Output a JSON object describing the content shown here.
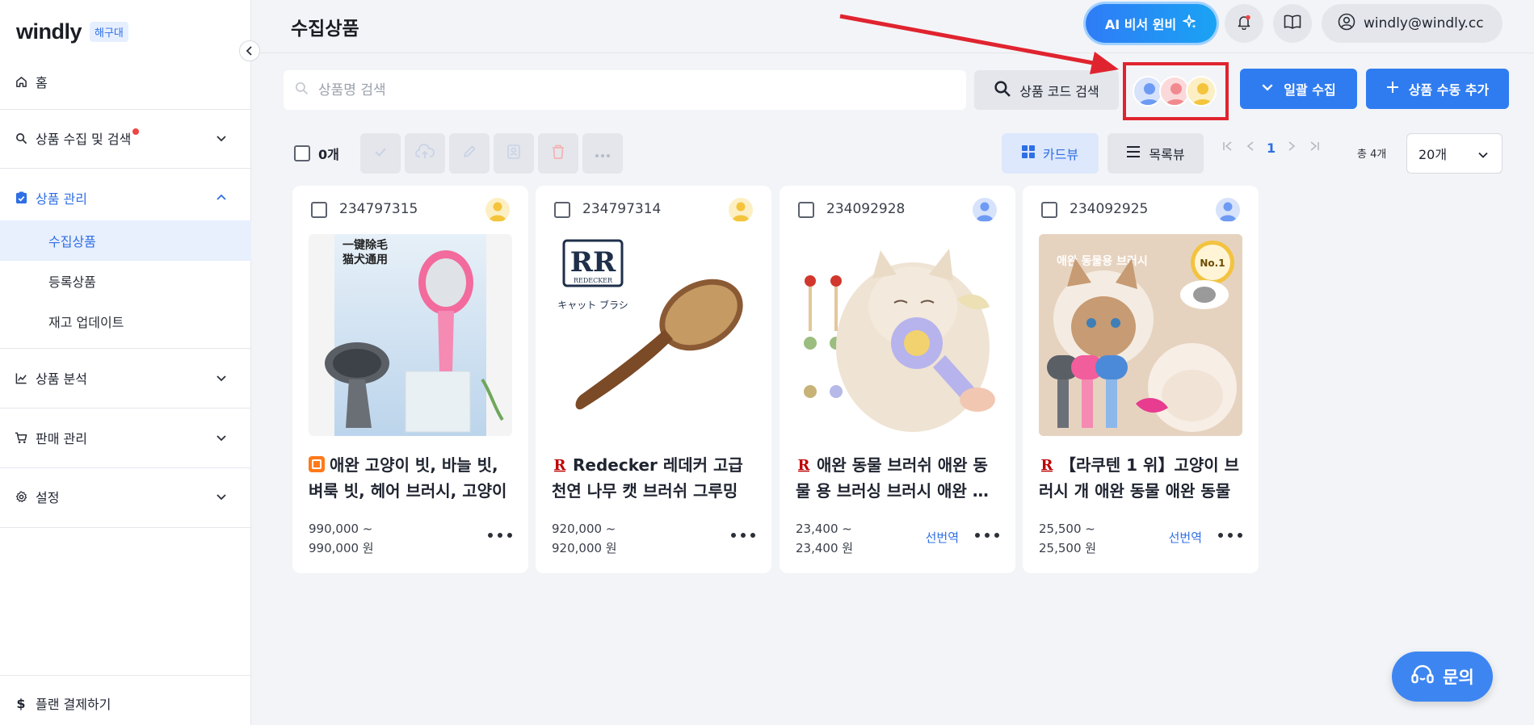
{
  "sidebar": {
    "logo": "windly",
    "badge": "해구대",
    "home": "홈",
    "collect": "상품 수집 및 검색",
    "manage": "상품 관리",
    "sub": [
      "수집상품",
      "등록상품",
      "재고 업데이트"
    ],
    "analysis": "상품 분석",
    "sales": "판매 관리",
    "settings": "설정",
    "plan": "플랜 결제하기"
  },
  "header": {
    "title": "수집상품",
    "ai_label": "AI 비서 윈비",
    "user_email": "windly@windly.cc"
  },
  "search": {
    "placeholder": "상품명 검색",
    "code_label": "상품 코드 검색",
    "bulk_label": "일괄 수집",
    "manual_label": "상품 수동 추가"
  },
  "toolbar": {
    "selected_count": "0개",
    "card_view": "카드뷰",
    "list_view": "목록뷰",
    "page": "1",
    "total": "총 4개",
    "per_page": "20개"
  },
  "products": [
    {
      "id": "234797315",
      "title": "애완 고양이 빗, 바늘 빗, 벼룩 빗, 헤어 브러시, 고양이",
      "price_min": "990,000 ~",
      "price_max": "990,000 원",
      "tag": "",
      "market": "taobao",
      "avatar": "yellow",
      "img_text1": "一键除毛",
      "img_text2": "猫犬通用"
    },
    {
      "id": "234797314",
      "title": "Redecker 레데커 고급 천연 나무 캣 브러쉬 그루밍",
      "price_min": "920,000 ~",
      "price_max": "920,000 원",
      "tag": "",
      "market": "rakuten",
      "avatar": "yellow",
      "img_text1": "REDECKER",
      "img_text2": "キャット ブラシ"
    },
    {
      "id": "234092928",
      "title": "애완 동물 브러쉬 애완 동물 용 브러싱 브러시 애완 동물",
      "price_min": "23,400 ~",
      "price_max": "23,400 원",
      "tag": "선번역",
      "market": "rakuten",
      "avatar": "blue",
      "img_text1": "",
      "img_text2": ""
    },
    {
      "id": "234092925",
      "title": "【라쿠텐 1 위】고양이 브러시 개 애완 동물 애완 동물",
      "price_min": "25,500 ~",
      "price_max": "25,500 원",
      "tag": "선번역",
      "market": "rakuten",
      "avatar": "blue",
      "img_text1": "애완 동물용 브러시",
      "img_text2": "No.1"
    }
  ],
  "inquiry_label": "문의",
  "colors": {
    "accent": "#2f7cf0",
    "annotation": "#e0242f",
    "active_bg": "#e8effd"
  }
}
